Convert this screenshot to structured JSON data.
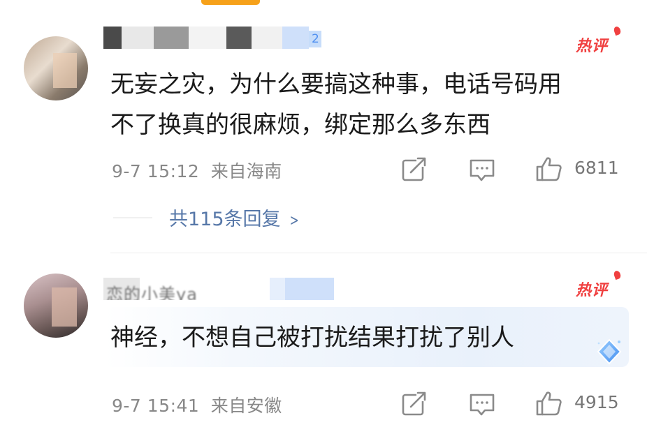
{
  "comments": [
    {
      "username": "",
      "username_badge": "2",
      "hot_label": "热评",
      "text_lines": [
        "无妄之灾，为什么要搞这种事，电话号码用",
        "不了换真的很麻烦，绑定那么多东西"
      ],
      "date": "9-7 15:12",
      "location": "来自海南",
      "likes": "6811",
      "replies": "共115条回复"
    },
    {
      "username": "恋的小美ya_",
      "hot_label": "热评",
      "text_lines": [
        "神经，不想自己被打扰结果打扰了别人"
      ],
      "date": "9-7 15:41",
      "location": "来自安徽",
      "likes": "4915"
    }
  ],
  "icons": {
    "share": "share-icon",
    "reply": "comment-icon",
    "like": "thumbs-up-icon",
    "badge": "diamond-badge-icon"
  },
  "colors": {
    "hot": "#f04040",
    "link": "#5677a8",
    "meta": "#888888",
    "accent_tab": "#f6a11a"
  }
}
